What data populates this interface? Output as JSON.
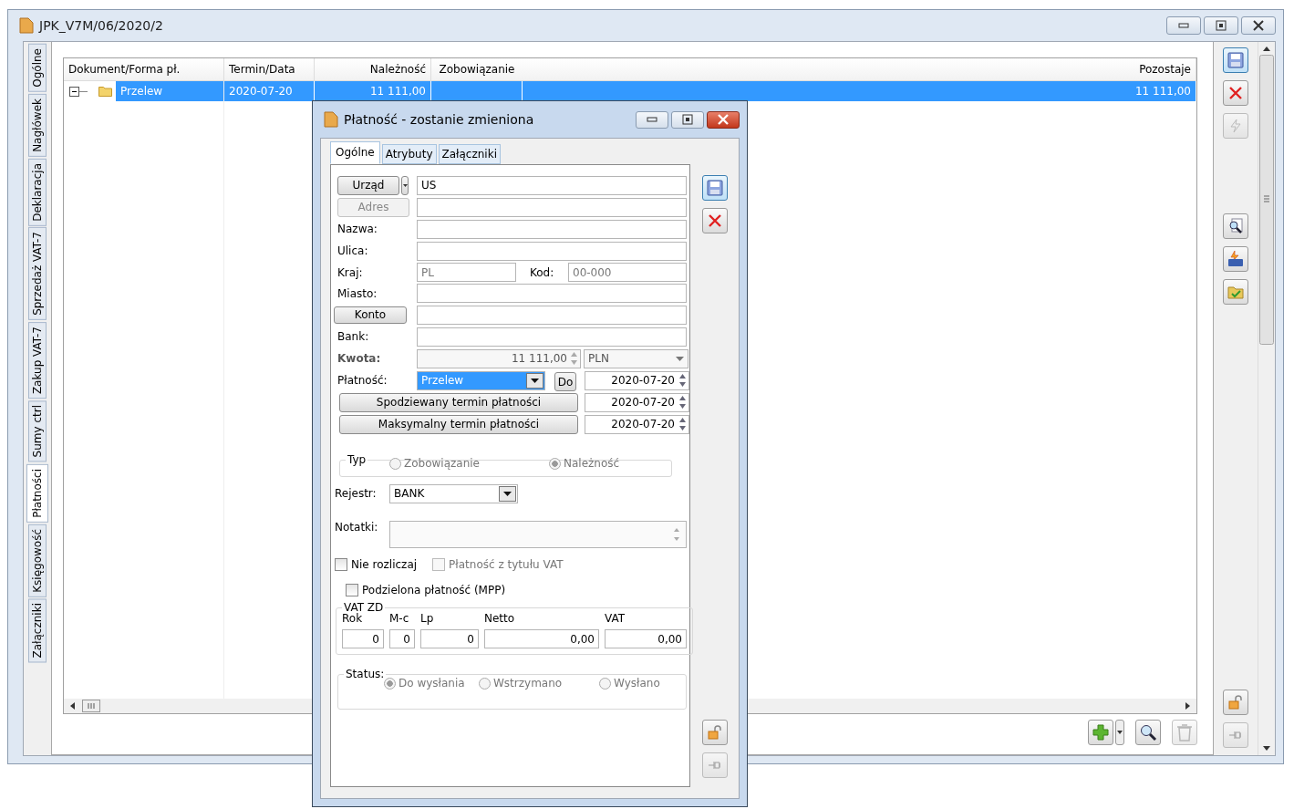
{
  "window": {
    "title": "JPK_V7M/06/2020/2"
  },
  "side_tabs": [
    {
      "label": "Ogólne",
      "selected": false
    },
    {
      "label": "Nagłówek",
      "selected": false
    },
    {
      "label": "Deklaracja",
      "selected": false
    },
    {
      "label": "Sprzedaż VAT-7",
      "selected": false
    },
    {
      "label": "Zakup VAT-7",
      "selected": false
    },
    {
      "label": "Sumy ctrl",
      "selected": false
    },
    {
      "label": "Płatności",
      "selected": true
    },
    {
      "label": "Księgowość",
      "selected": false
    },
    {
      "label": "Załączniki",
      "selected": false
    }
  ],
  "table": {
    "columns": [
      "Dokument/Forma pł.",
      "Termin/Data",
      "Należność",
      "Zobowiązanie",
      "Pozostaje"
    ],
    "rows": [
      {
        "expanded": true,
        "selected": true,
        "document": "Przelew",
        "date": "2020-07-20",
        "receivable": "11 111,00",
        "remaining": "11 111,00"
      }
    ]
  },
  "dialog": {
    "title": "Płatność - zostanie zmieniona",
    "tabs": [
      {
        "label": "Ogólne",
        "selected": true
      },
      {
        "label": "Atrybuty",
        "selected": false
      },
      {
        "label": "Załączniki",
        "selected": false
      }
    ],
    "urzad": {
      "button": "Urząd",
      "value": "US"
    },
    "adres": {
      "button": "Adres",
      "disabled": true
    },
    "nazwa": {
      "label": "Nazwa:"
    },
    "ulica": {
      "label": "Ulica:"
    },
    "kraj": {
      "label": "Kraj:",
      "placeholder": "PL"
    },
    "kod": {
      "label": "Kod:",
      "placeholder": "00-000"
    },
    "miasto": {
      "label": "Miasto:"
    },
    "konto": {
      "button": "Konto"
    },
    "bank": {
      "label": "Bank:"
    },
    "kwota": {
      "label": "Kwota:",
      "value": "11 111,00",
      "currency": "PLN"
    },
    "platnosc": {
      "label": "Płatność:",
      "value": "Przelew",
      "do_button": "Do",
      "date": "2020-07-20"
    },
    "terms": [
      {
        "button": "Spodziewany termin płatności",
        "date": "2020-07-20"
      },
      {
        "button": "Maksymalny termin płatności",
        "date": "2020-07-20"
      }
    ],
    "typ": {
      "legend": "Typ",
      "options": [
        {
          "label": "Zobowiązanie",
          "selected": false
        },
        {
          "label": "Należność",
          "selected": true
        }
      ]
    },
    "rejestr": {
      "label": "Rejestr:",
      "value": "BANK"
    },
    "notatki": {
      "label": "Notatki:"
    },
    "checks_row": [
      {
        "label": "Nie rozliczaj",
        "checked": false,
        "disabled": false
      },
      {
        "label": "Płatność z tytułu VAT",
        "checked": false,
        "disabled": true
      }
    ],
    "mpp": {
      "label": "Podzielona płatność (MPP)",
      "checked": false,
      "disabled": false
    },
    "vat_zd": {
      "legend": "VAT ZD",
      "fields": [
        {
          "label": "Rok",
          "value": "0"
        },
        {
          "label": "M-c",
          "value": "0"
        },
        {
          "label": "Lp",
          "value": "0"
        },
        {
          "label": "Netto",
          "value": "0,00"
        },
        {
          "label": "VAT",
          "value": "0,00"
        }
      ]
    },
    "status": {
      "legend": "Status:",
      "options": [
        {
          "label": "Do wysłania",
          "selected": true
        },
        {
          "label": "Wstrzymano",
          "selected": false
        },
        {
          "label": "Wysłano",
          "selected": false
        }
      ]
    }
  }
}
